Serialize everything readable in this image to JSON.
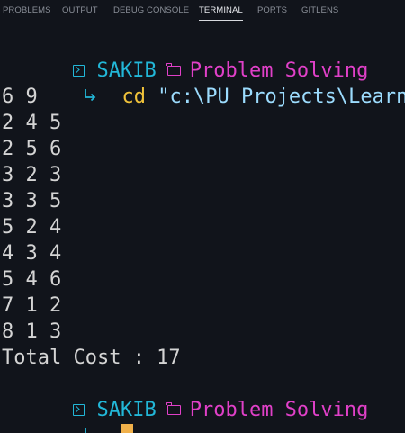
{
  "panel_tabs": [
    {
      "label": "PROBLEMS",
      "active": false
    },
    {
      "label": "OUTPUT",
      "active": false
    },
    {
      "label": "DEBUG CONSOLE",
      "active": false
    },
    {
      "label": "TERMINAL",
      "active": true
    },
    {
      "label": "PORTS",
      "active": false
    },
    {
      "label": "GITLENS",
      "active": false
    }
  ],
  "terminal": {
    "prompt1": {
      "user": "SAKIB",
      "directory": "Problem Solving",
      "command": "cd",
      "argument": "\"c:\\PU Projects\\LearnCPP\\"
    },
    "output_lines": [
      "6 9",
      "2 4 5",
      "2 5 6",
      "3 2 3",
      "3 3 5",
      "5 2 4",
      "4 3 4",
      "5 4 6",
      "7 1 2",
      "8 1 3",
      "Total Cost : 17"
    ],
    "prompt2": {
      "user": "SAKIB",
      "directory": "Problem Solving"
    }
  },
  "colors": {
    "background": "#11141b",
    "user": "#22b7d8",
    "directory": "#e040c8",
    "command": "#f0c23a",
    "argument": "#9cdcfe",
    "cursor": "#f0b04a",
    "output_text": "#d4d4d4"
  },
  "icons": {
    "prompt": "terminal-prompt-icon",
    "folder": "folder-icon",
    "continuation": "return-arrow-icon"
  }
}
